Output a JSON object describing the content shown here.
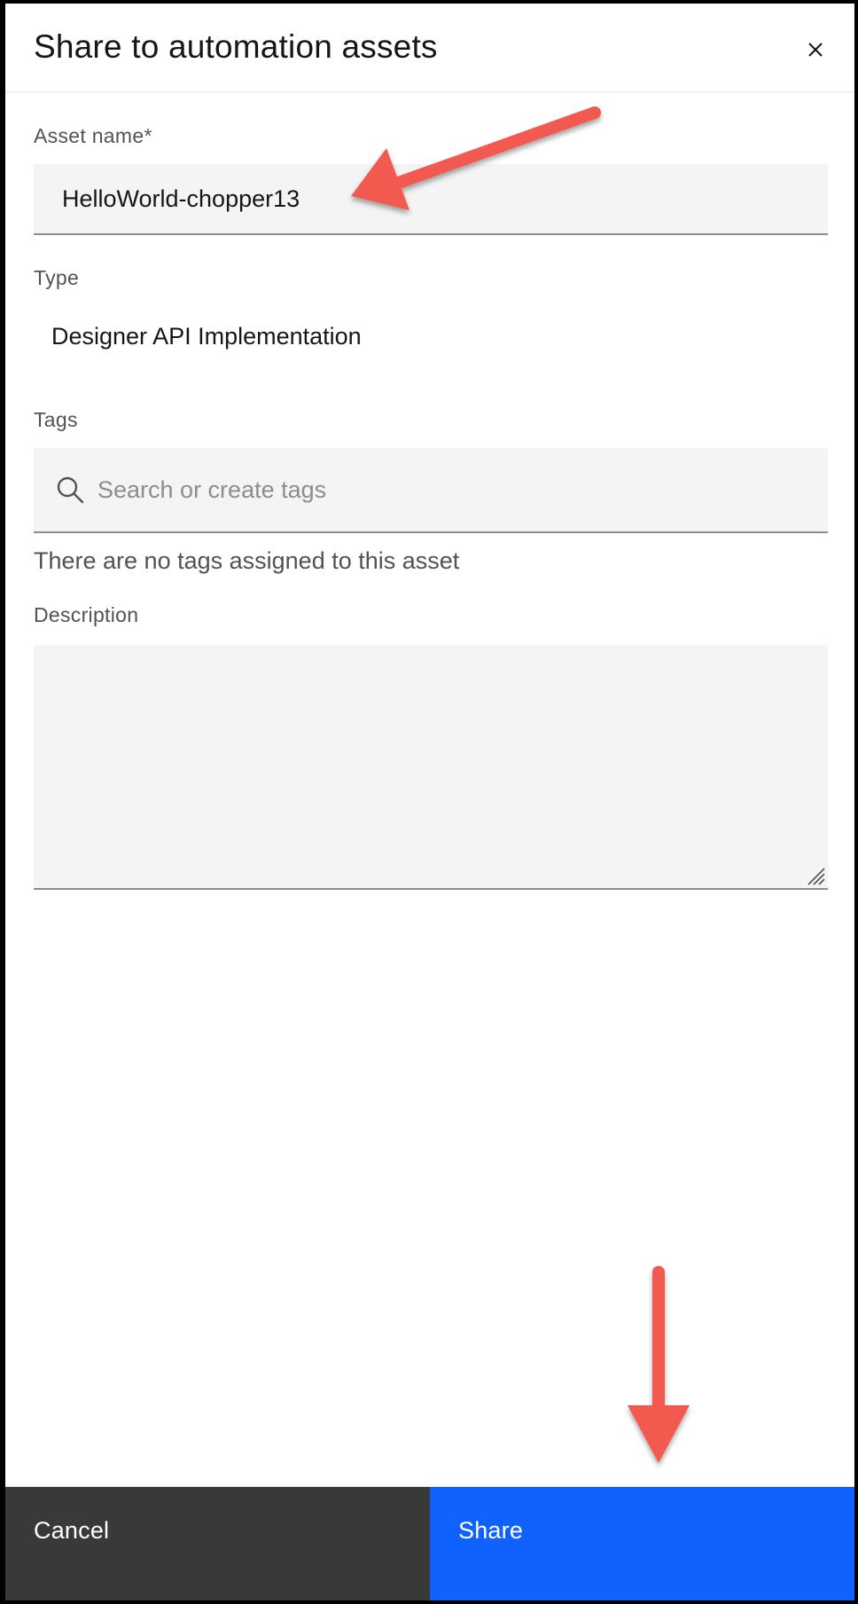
{
  "dialog": {
    "title": "Share to automation assets",
    "close_icon": "close-icon"
  },
  "form": {
    "asset_name": {
      "label": "Asset name*",
      "value": "HelloWorld-chopper13"
    },
    "type": {
      "label": "Type",
      "value": "Designer API Implementation"
    },
    "tags": {
      "label": "Tags",
      "placeholder": "Search or create tags",
      "icon": "search-icon",
      "empty_message": "There are no tags assigned to this asset"
    },
    "description": {
      "label": "Description",
      "value": ""
    }
  },
  "footer": {
    "cancel_label": "Cancel",
    "share_label": "Share"
  },
  "colors": {
    "primary": "#0f62fe",
    "secondary": "#393939",
    "field_bg": "#f4f4f4",
    "annotation_arrow": "#f25a4f"
  },
  "annotations": [
    {
      "name": "annotation-arrow",
      "points_to": "asset-name-input"
    },
    {
      "name": "annotation-arrow",
      "points_to": "share-button"
    }
  ]
}
